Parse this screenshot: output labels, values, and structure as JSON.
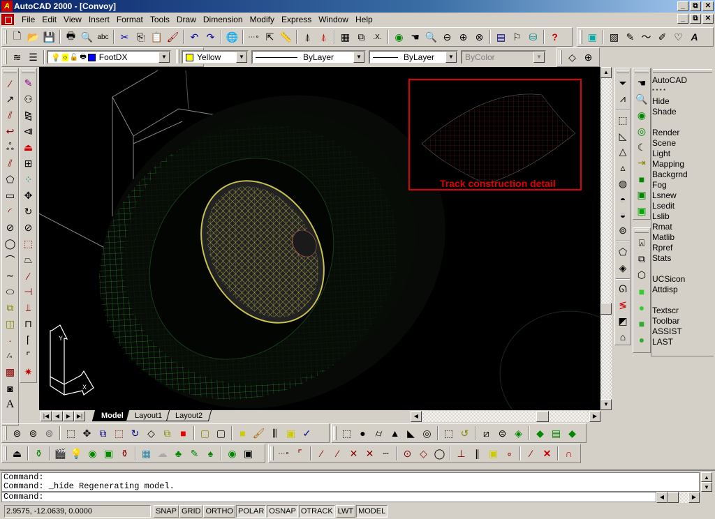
{
  "window": {
    "title": "AutoCAD 2000 - [Convoy]",
    "controls": [
      "_",
      "⧉",
      "✕"
    ]
  },
  "menu": [
    "File",
    "Edit",
    "View",
    "Insert",
    "Format",
    "Tools",
    "Draw",
    "Dimension",
    "Modify",
    "Express",
    "Window",
    "Help"
  ],
  "standard_toolbar": {
    "icons": [
      "new",
      "open",
      "save",
      "print",
      "print-preview",
      "spelling",
      "cut",
      "copy",
      "paste",
      "match-properties",
      "undo",
      "redo",
      "hyperlink",
      "tracking",
      "ucs",
      "distance",
      "named-views",
      "named-views-2",
      "tiled-viewports",
      "realtime-pan",
      "3d-orbit",
      "pan",
      "zoom-realtime",
      "zoom-window",
      "zoom-previous",
      "aerial-view",
      "properties",
      "design-center",
      "dbconnect",
      "help"
    ]
  },
  "layers_toolbar": {
    "layer_name": "FootDX",
    "layer_color": "#0000ff",
    "color_value": "Yellow",
    "color_swatch": "#ffff00",
    "linetype_value": "ByLayer",
    "lineweight_value": "ByLayer",
    "plotstyle_value": "ByColor"
  },
  "viewport": {
    "inset_caption": "Track construction detail",
    "inset_color": "#e00000",
    "ucs_x": "X",
    "ucs_y": "Y"
  },
  "tabs": [
    "Model",
    "Layout1",
    "Layout2"
  ],
  "active_tab": "Model",
  "right_list": [
    "AutoCAD",
    "* * * *",
    "Hide",
    "Shade",
    "",
    "Render",
    "Scene",
    "Light",
    "Mapping",
    "Backgrnd",
    "Fog",
    "Lsnew",
    "Lsedit",
    "Lslib",
    "Rmat",
    "Matlib",
    "Rpref",
    "Stats",
    "",
    "UCSicon",
    "Attdisp",
    "",
    "Textscr",
    "Toolbar",
    "ASSIST",
    "LAST"
  ],
  "command": {
    "history": [
      "Command:",
      "Command: _hide Regenerating model."
    ],
    "prompt": "Command:"
  },
  "status": {
    "coords": "2.9575,  -12.0639, 0.0000",
    "toggles": [
      {
        "label": "SNAP",
        "on": false
      },
      {
        "label": "GRID",
        "on": false
      },
      {
        "label": "ORTHO",
        "on": false
      },
      {
        "label": "POLAR",
        "on": true
      },
      {
        "label": "OSNAP",
        "on": true
      },
      {
        "label": "OTRACK",
        "on": true
      },
      {
        "label": "LWT",
        "on": false
      },
      {
        "label": "MODEL",
        "on": true
      }
    ]
  }
}
